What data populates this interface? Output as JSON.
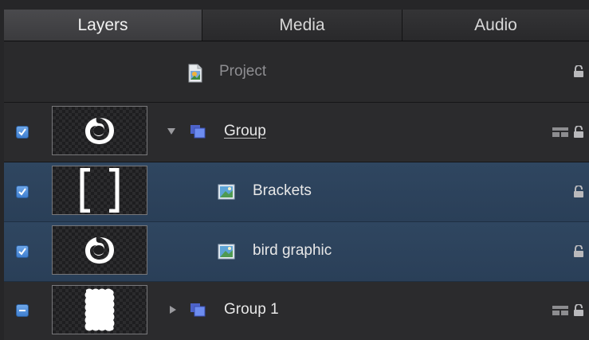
{
  "tabs": [
    {
      "label": "Layers",
      "active": true
    },
    {
      "label": "Media",
      "active": false
    },
    {
      "label": "Audio",
      "active": false
    }
  ],
  "project": {
    "label": "Project"
  },
  "rows": [
    {
      "label": "Group",
      "checked": true,
      "expanded": true,
      "type": "group",
      "thumbnail": "bird-shape"
    },
    {
      "label": "Brackets",
      "checked": true,
      "type": "image",
      "thumbnail": "brackets",
      "selected": true
    },
    {
      "label": "bird graphic",
      "checked": true,
      "type": "image",
      "thumbnail": "bird-shape",
      "selected": true
    },
    {
      "label": "Group 1",
      "checked": "mixed",
      "expanded": false,
      "type": "group",
      "thumbnail": "wavy-block"
    }
  ],
  "colors": {
    "accent": "#4a86d8",
    "selection": "#2c4259",
    "group_icon": "#5b78e0"
  },
  "icons": {
    "project": "project-file-icon",
    "group": "group-layers-icon",
    "image": "image-layer-icon",
    "lock": "lock-icon",
    "group_mark": "group-marker-icon"
  }
}
